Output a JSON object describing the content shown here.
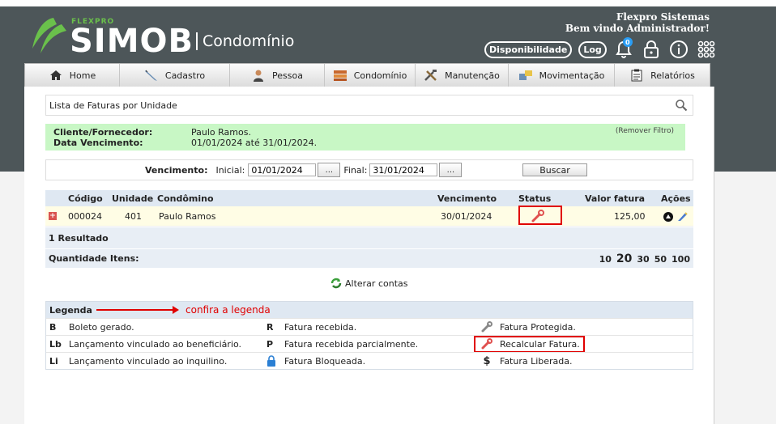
{
  "header": {
    "brand_small": "FLEXPRO",
    "brand_main": "SIMOB",
    "brand_sub": "Condomínio",
    "company": "Flexpro Sistemas",
    "welcome": "Bem vindo Administrador!",
    "disponibilidade_label": "Disponibilidade",
    "log_label": "Log",
    "notifications_count": "0"
  },
  "menu": {
    "items": [
      {
        "label": "Home",
        "icon": "home-icon"
      },
      {
        "label": "Cadastro",
        "icon": "pencil-icon"
      },
      {
        "label": "Pessoa",
        "icon": "person-icon"
      },
      {
        "label": "Condomínio",
        "icon": "stack-icon"
      },
      {
        "label": "Manutenção",
        "icon": "tools-icon"
      },
      {
        "label": "Movimentação",
        "icon": "transfer-icon"
      },
      {
        "label": "Relatórios",
        "icon": "clipboard-icon"
      }
    ]
  },
  "page": {
    "title": "Lista de Faturas por Unidade"
  },
  "filter": {
    "client_label": "Cliente/Fornecedor:",
    "client_value": "Paulo Ramos.",
    "due_label": "Data Vencimento:",
    "due_value": "01/01/2024 até 31/01/2024.",
    "remove_label": "(Remover Filtro)"
  },
  "search": {
    "vencimento_label": "Vencimento:",
    "inicial_label": "Inicial:",
    "inicial_value": "01/01/2024",
    "final_label": "Final:",
    "final_value": "31/01/2024",
    "dots_label": "...",
    "buscar_label": "Buscar"
  },
  "table": {
    "headers": {
      "codigo": "Código",
      "unidade": "Unidade",
      "condomino": "Condômino",
      "vencimento": "Vencimento",
      "status": "Status",
      "valor": "Valor fatura",
      "acoes": "Ações"
    },
    "rows": [
      {
        "codigo": "000024",
        "unidade": "401",
        "condomino": "Paulo Ramos",
        "vencimento": "30/01/2024",
        "status_icon": "recalculate-icon",
        "valor": "125,00"
      }
    ],
    "result_count": "1 Resultado",
    "quantity_label": "Quantidade Itens:",
    "page_sizes": [
      "10",
      "20",
      "30",
      "50",
      "100"
    ],
    "selected_page_size": "20"
  },
  "alterar_contas_label": "Alterar contas",
  "legend": {
    "title": "Legenda",
    "annotation": "confira a legenda",
    "rows": [
      {
        "c1_code": "B",
        "c1_text": "Boleto gerado.",
        "c2_code": "R",
        "c2_text": "Fatura recebida.",
        "c3_icon": "wrench-gray-icon",
        "c3_text": "Fatura Protegida."
      },
      {
        "c1_code": "Lb",
        "c1_text": "Lançamento vinculado ao beneficiário.",
        "c2_code": "P",
        "c2_text": "Fatura recebida parcialmente.",
        "c3_icon": "wrench-red-icon",
        "c3_text": "Recalcular Fatura."
      },
      {
        "c1_code": "Li",
        "c1_text": "Lançamento vinculado ao inquilino.",
        "c2_code": "lock-icon",
        "c2_text": "Fatura Bloqueada.",
        "c3_icon": "dollar-icon",
        "c3_text": "Fatura Liberada."
      }
    ]
  },
  "colors": {
    "header_bg": "#4d5659",
    "brand_green": "#6ac04b",
    "filter_bg": "#c8f7c5",
    "highlight_red": "#e00000",
    "row_bg": "#fffde5",
    "grid_head_bg": "#dfe8f2"
  }
}
